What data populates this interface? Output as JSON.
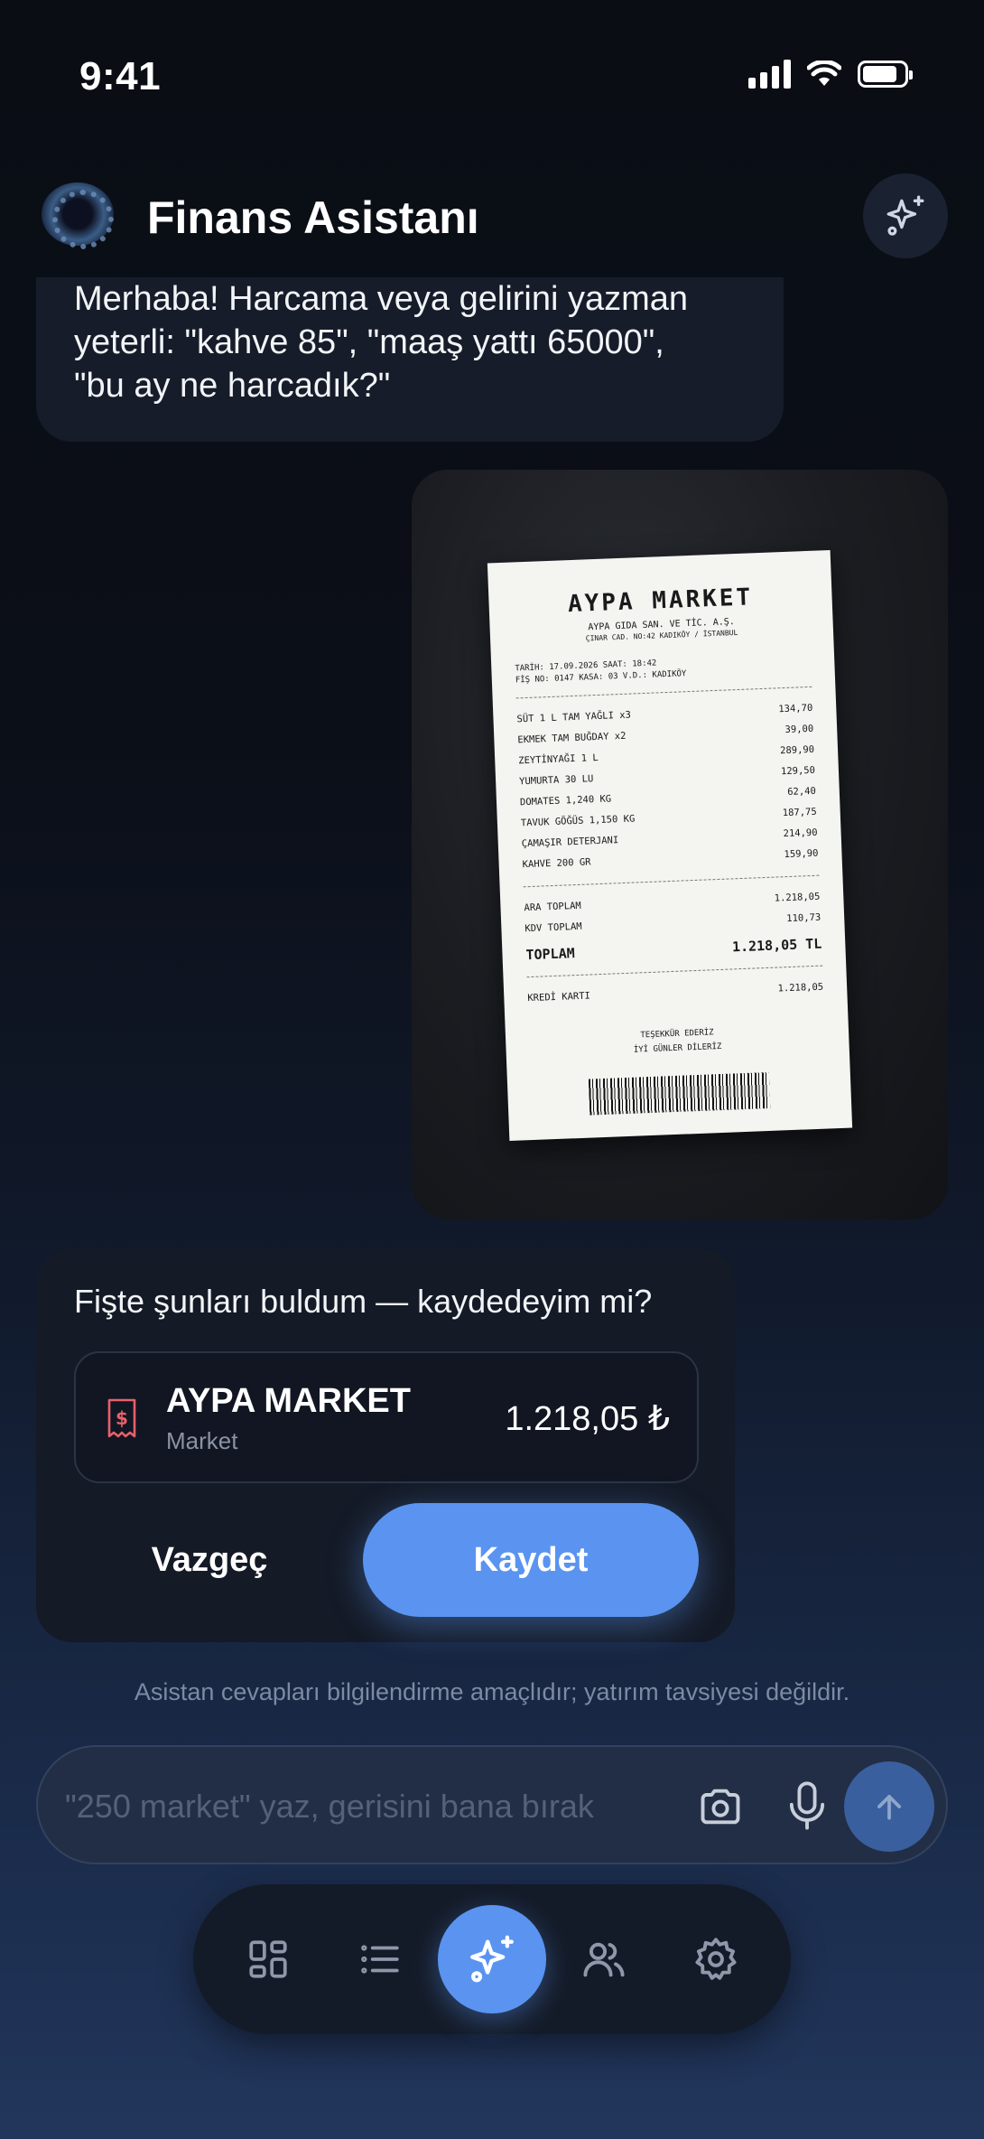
{
  "status_bar": {
    "time": "9:41"
  },
  "header": {
    "title": "Finans Asistanı",
    "ai_icon": "sparkle-icon"
  },
  "messages": {
    "bot_greeting_lines": [
      "Merhaba! Harcama veya gelirini yazman",
      "yeterli: \"kahve 85\", \"maaş yattı 65000\",",
      "\"bu ay ne harcadık?\""
    ]
  },
  "receipt_photo": {
    "store": "AYPA MARKET",
    "company": "AYPA GIDA SAN. VE TİC. A.Ş.",
    "address": "ÇINAR CAD. NO:42 KADIKÖY / İSTANBUL",
    "meta_line1": "TARİH: 17.09.2026 SAAT: 18:42",
    "meta_line2": "FİŞ NO: 0147 KASA: 03 V.D.: KADIKÖY",
    "items": [
      {
        "name": "SÜT 1 L TAM YAĞLI x3",
        "price": "134,70"
      },
      {
        "name": "EKMEK TAM BUĞDAY x2",
        "price": "39,00"
      },
      {
        "name": "ZEYTİNYAĞI 1 L",
        "price": "289,90"
      },
      {
        "name": "YUMURTA 30 LU",
        "price": "129,50"
      },
      {
        "name": "DOMATES 1,240 KG",
        "price": "62,40"
      },
      {
        "name": "TAVUK GÖĞÜS 1,150 KG",
        "price": "187,75"
      },
      {
        "name": "ÇAMAŞIR DETERJANI",
        "price": "214,90"
      },
      {
        "name": "KAHVE 200 GR",
        "price": "159,90"
      }
    ],
    "subtotal_label": "ARA TOPLAM",
    "subtotal": "1.218,05",
    "vat_label": "KDV TOPLAM",
    "vat": "110,73",
    "total_label": "TOPLAM",
    "total": "1.218,05 TL",
    "payment_label": "KREDİ KARTI",
    "payment": "1.218,05",
    "thanks1": "TEŞEKKÜR EDERİZ",
    "thanks2": "İYİ GÜNLER DİLERİZ"
  },
  "confirm": {
    "question": "Fişte şunları buldum — kaydedeyim mi?",
    "merchant_name": "AYPA MARKET",
    "category": "Market",
    "amount": "1.218,05 ₺",
    "receipt_icon": "receipt-icon",
    "cancel_label": "Vazgeç",
    "save_label": "Kaydet"
  },
  "disclaimer": "Asistan cevapları bilgilendirme amaçlıdır; yatırım tavsiyesi değildir.",
  "input": {
    "placeholder": "\"250 market\" yaz, gerisini bana bırak",
    "value": "",
    "camera_icon": "camera-icon",
    "mic_icon": "microphone-icon",
    "send_icon": "arrow-up-icon"
  },
  "nav": {
    "items": [
      "dashboard-icon",
      "list-icon",
      "sparkle-icon",
      "users-icon",
      "settings-icon"
    ],
    "active": "sparkle-icon"
  },
  "colors": {
    "accent": "#5a94f0",
    "receipt_icon": "#e8606a"
  }
}
